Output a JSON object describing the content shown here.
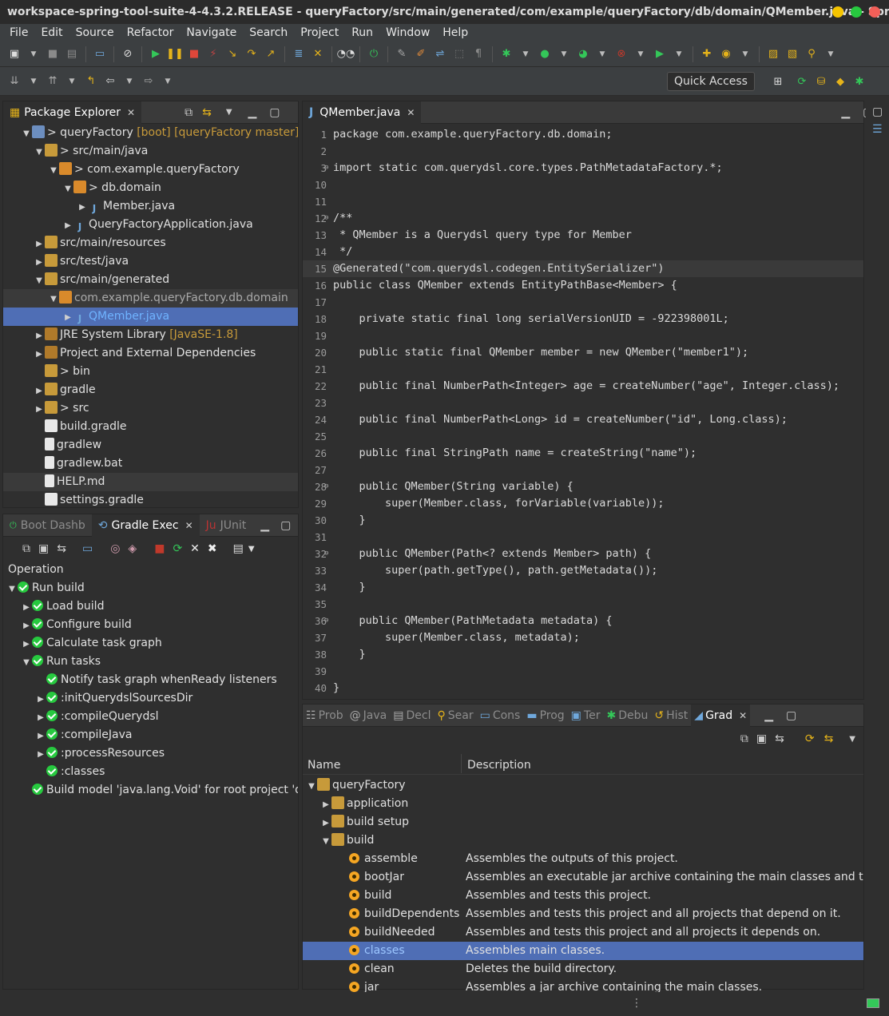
{
  "window": {
    "title": "workspace-spring-tool-suite-4-4.3.2.RELEASE - queryFactory/src/main/generated/com/example/queryFactory/db/domain/QMember.java - Sprin..."
  },
  "menu": [
    "File",
    "Edit",
    "Source",
    "Refactor",
    "Navigate",
    "Search",
    "Project",
    "Run",
    "Window",
    "Help"
  ],
  "toolbar": {
    "quick_access": "Quick Access"
  },
  "package_explorer": {
    "tab": "Package Explorer",
    "items": [
      {
        "label": "> queryFactory",
        "extra": "[boot] [queryFactory master]"
      },
      {
        "label": "> src/main/java",
        "extra": ""
      },
      {
        "label": "> com.example.queryFactory",
        "extra": ""
      },
      {
        "label": "> db.domain",
        "extra": ""
      },
      {
        "label": "Member.java",
        "extra": ""
      },
      {
        "label": "QueryFactoryApplication.java",
        "extra": ""
      },
      {
        "label": "src/main/resources",
        "extra": ""
      },
      {
        "label": "src/test/java",
        "extra": ""
      },
      {
        "label": "src/main/generated",
        "extra": ""
      },
      {
        "label": "com.example.queryFactory.db.domain",
        "extra": ""
      },
      {
        "label": "QMember.java",
        "extra": ""
      },
      {
        "label": "JRE System Library",
        "extra": "[JavaSE-1.8]"
      },
      {
        "label": "Project and External Dependencies",
        "extra": ""
      },
      {
        "label": "> bin",
        "extra": ""
      },
      {
        "label": "gradle",
        "extra": ""
      },
      {
        "label": "> src",
        "extra": ""
      },
      {
        "label": "build.gradle",
        "extra": ""
      },
      {
        "label": "gradlew",
        "extra": ""
      },
      {
        "label": "gradlew.bat",
        "extra": ""
      },
      {
        "label": "HELP.md",
        "extra": ""
      },
      {
        "label": "settings.gradle",
        "extra": ""
      }
    ]
  },
  "gradle_exec": {
    "tabs": [
      "Boot Dashb",
      "Gradle Exec",
      "JUnit"
    ],
    "header": "Operation",
    "items": [
      "Run build",
      "Load build",
      "Configure build",
      "Calculate task graph",
      "Run tasks",
      "Notify task graph whenReady listeners",
      ":initQuerydslSourcesDir",
      ":compileQuerydsl",
      ":compileJava",
      ":processResources",
      ":classes",
      "Build model 'java.lang.Void' for root project 'qu"
    ]
  },
  "editor": {
    "tab": "QMember.java",
    "lines": [
      {
        "n": "1",
        "t": "package com.example.queryFactory.db.domain;"
      },
      {
        "n": "2",
        "t": ""
      },
      {
        "n": "3",
        "t": "import static com.querydsl.core.types.PathMetadataFactory.*;"
      },
      {
        "n": "10",
        "t": ""
      },
      {
        "n": "11",
        "t": ""
      },
      {
        "n": "12",
        "t": "/**"
      },
      {
        "n": "13",
        "t": " * QMember is a Querydsl query type for Member"
      },
      {
        "n": "14",
        "t": " */"
      },
      {
        "n": "15",
        "t": "@Generated(\"com.querydsl.codegen.EntitySerializer\")"
      },
      {
        "n": "16",
        "t": "public class QMember extends EntityPathBase<Member> {"
      },
      {
        "n": "17",
        "t": ""
      },
      {
        "n": "18",
        "t": "    private static final long serialVersionUID = -922398001L;"
      },
      {
        "n": "19",
        "t": ""
      },
      {
        "n": "20",
        "t": "    public static final QMember member = new QMember(\"member1\");"
      },
      {
        "n": "21",
        "t": ""
      },
      {
        "n": "22",
        "t": "    public final NumberPath<Integer> age = createNumber(\"age\", Integer.class);"
      },
      {
        "n": "23",
        "t": ""
      },
      {
        "n": "24",
        "t": "    public final NumberPath<Long> id = createNumber(\"id\", Long.class);"
      },
      {
        "n": "25",
        "t": ""
      },
      {
        "n": "26",
        "t": "    public final StringPath name = createString(\"name\");"
      },
      {
        "n": "27",
        "t": ""
      },
      {
        "n": "28",
        "t": "    public QMember(String variable) {"
      },
      {
        "n": "29",
        "t": "        super(Member.class, forVariable(variable));"
      },
      {
        "n": "30",
        "t": "    }"
      },
      {
        "n": "31",
        "t": ""
      },
      {
        "n": "32",
        "t": "    public QMember(Path<? extends Member> path) {"
      },
      {
        "n": "33",
        "t": "        super(path.getType(), path.getMetadata());"
      },
      {
        "n": "34",
        "t": "    }"
      },
      {
        "n": "35",
        "t": ""
      },
      {
        "n": "36",
        "t": "    public QMember(PathMetadata metadata) {"
      },
      {
        "n": "37",
        "t": "        super(Member.class, metadata);"
      },
      {
        "n": "38",
        "t": "    }"
      },
      {
        "n": "39",
        "t": ""
      },
      {
        "n": "40",
        "t": "}"
      }
    ]
  },
  "bottom_tabs": [
    "Prob",
    "Java",
    "Decl",
    "Sear",
    "Cons",
    "Prog",
    "Ter",
    "Debu",
    "Hist",
    "Grad"
  ],
  "gradle_tasks": {
    "col_name": "Name",
    "col_desc": "Description",
    "root": "queryFactory",
    "groups": [
      "application",
      "build setup",
      "build"
    ],
    "tasks": [
      {
        "name": "assemble",
        "desc": "Assembles the outputs of this project."
      },
      {
        "name": "bootJar",
        "desc": "Assembles an executable jar archive containing the main classes and their d"
      },
      {
        "name": "build",
        "desc": "Assembles and tests this project."
      },
      {
        "name": "buildDependents",
        "desc": "Assembles and tests this project and all projects that depend on it."
      },
      {
        "name": "buildNeeded",
        "desc": "Assembles and tests this project and all projects it depends on."
      },
      {
        "name": "classes",
        "desc": "Assembles main classes."
      },
      {
        "name": "clean",
        "desc": "Deletes the build directory."
      },
      {
        "name": "jar",
        "desc": "Assembles a jar archive containing the main classes."
      }
    ]
  }
}
